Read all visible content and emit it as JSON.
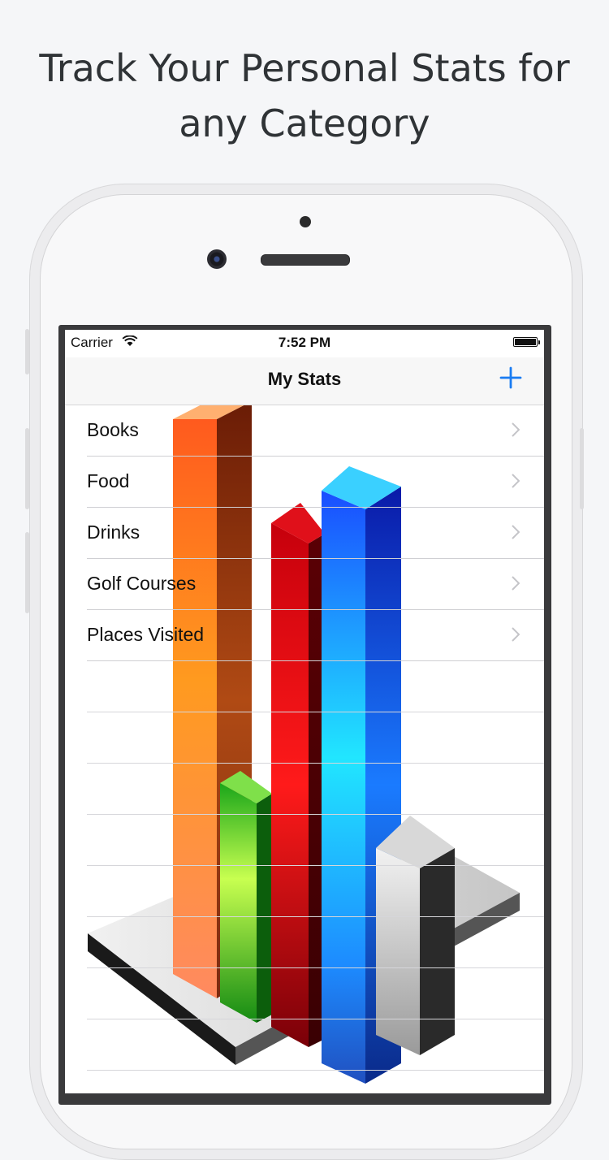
{
  "headline": {
    "line1": "Track Your Personal Stats for",
    "line2": "any Category"
  },
  "status_bar": {
    "carrier": "Carrier",
    "time": "7:52 PM"
  },
  "nav": {
    "title": "My Stats",
    "add_icon": "plus-icon"
  },
  "list": {
    "items": [
      {
        "label": "Books"
      },
      {
        "label": "Food"
      },
      {
        "label": "Drinks"
      },
      {
        "label": "Golf Courses"
      },
      {
        "label": "Places Visited"
      }
    ]
  },
  "colors": {
    "accent": "#1a7cf2",
    "background": "#f5f6f8"
  }
}
